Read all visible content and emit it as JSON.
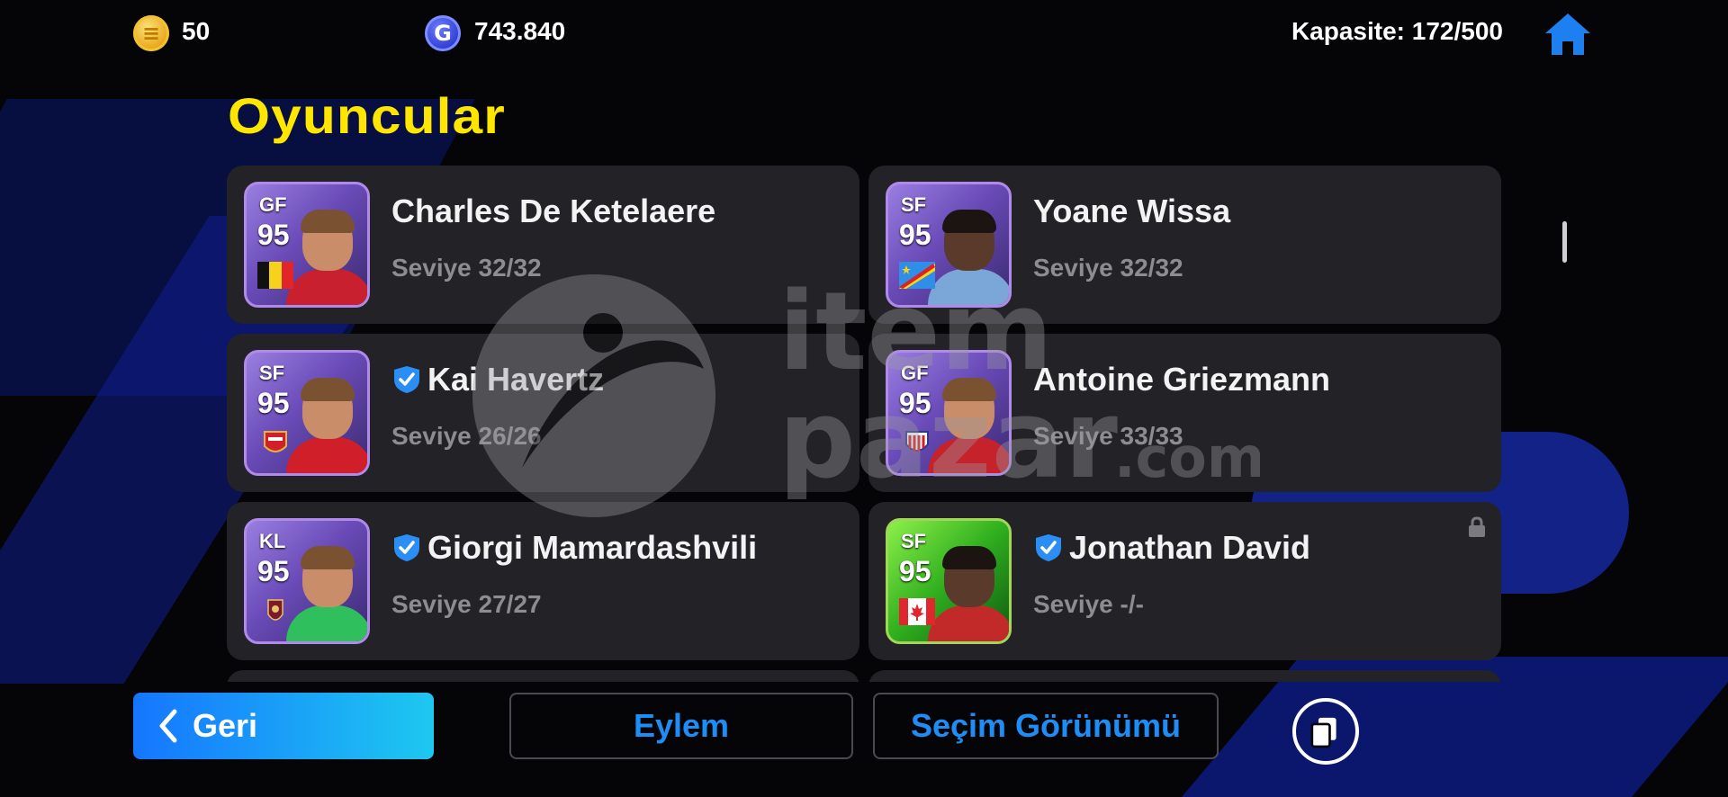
{
  "topbar": {
    "coin_value": "50",
    "gp_value": "743.840",
    "capacity": "Kapasite: 172/500"
  },
  "page_title": "Oyuncular",
  "players": [
    {
      "position": "GF",
      "rating": "95",
      "name": "Charles De Ketelaere",
      "level": "Seviye 32/32",
      "verified": false,
      "locked": false,
      "card_style": "purple",
      "badge": "belgium-flag",
      "jersey_color": "#c8202f"
    },
    {
      "position": "SF",
      "rating": "95",
      "name": "Yoane Wissa",
      "level": "Seviye 32/32",
      "verified": false,
      "locked": false,
      "card_style": "purple",
      "badge": "dr-congo-flag",
      "jersey_color": "#7aa7d8"
    },
    {
      "position": "SF",
      "rating": "95",
      "name": "Kai Havertz",
      "level": "Seviye 26/26",
      "verified": true,
      "locked": false,
      "card_style": "purple",
      "badge": "arsenal-crest",
      "jersey_color": "#d11f2a"
    },
    {
      "position": "GF",
      "rating": "95",
      "name": "Antoine Griezmann",
      "level": "Seviye 33/33",
      "verified": false,
      "locked": false,
      "card_style": "purple",
      "badge": "atletico-crest",
      "jersey_color": "#c5222b"
    },
    {
      "position": "KL",
      "rating": "95",
      "name": "Giorgi Mamardashvili",
      "level": "Seviye 27/27",
      "verified": true,
      "locked": false,
      "card_style": "purple",
      "badge": "liverpool-crest",
      "jersey_color": "#2fbf5d"
    },
    {
      "position": "SF",
      "rating": "95",
      "name": "Jonathan David",
      "level": "Seviye -/-",
      "verified": true,
      "locked": true,
      "card_style": "green",
      "badge": "canada-flag",
      "jersey_color": "#c22a2a"
    }
  ],
  "buttons": {
    "back": "Geri",
    "action": "Eylem",
    "selection_view": "Seçim Görünümü"
  },
  "watermark": {
    "text_top": "item",
    "text_bottom": "pazar",
    "text_domain": ".com"
  },
  "icons": [
    "gold-coin-icon",
    "gp-coin-icon",
    "home-icon",
    "verified-check-icon",
    "lock-icon",
    "chevron-left-icon",
    "copy-cards-icon"
  ],
  "colors": {
    "title": "#ffe600",
    "accent_blue": "#1e8df5",
    "card_bg": "#232327"
  }
}
